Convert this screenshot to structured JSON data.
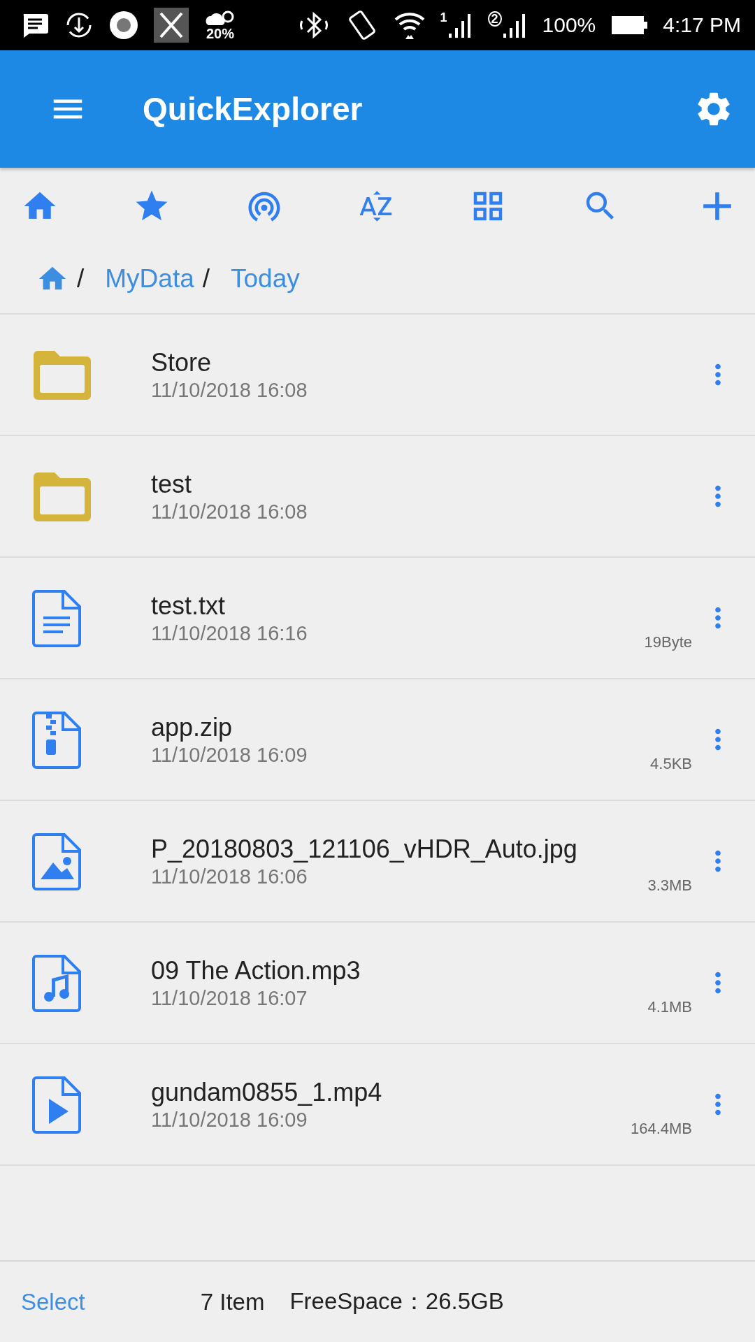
{
  "status_bar": {
    "weather_reading": "20%",
    "sim1_label": "1",
    "sim2_label": "2",
    "battery": "100%",
    "time": "4:17 PM"
  },
  "app_bar": {
    "title": "QuickExplorer"
  },
  "toolbar": [
    {
      "kind": "home"
    },
    {
      "kind": "star"
    },
    {
      "kind": "network"
    },
    {
      "kind": "sort"
    },
    {
      "kind": "grid"
    },
    {
      "kind": "search"
    },
    {
      "kind": "add"
    }
  ],
  "breadcrumb": [
    {
      "separator": "/",
      "label": "MyData"
    },
    {
      "separator": "/",
      "label": "Today"
    }
  ],
  "files": [
    {
      "name": "Store",
      "date": "11/10/2018 16:08",
      "kind": "folder"
    },
    {
      "name": "test",
      "date": "11/10/2018 16:08",
      "kind": "folder"
    },
    {
      "name": "test.txt",
      "date": "11/10/2018 16:16",
      "kind": "text",
      "size": "19Byte"
    },
    {
      "name": "app.zip",
      "date": "11/10/2018 16:09",
      "kind": "zip",
      "size": "4.5KB"
    },
    {
      "name": "P_20180803_121106_vHDR_Auto.jpg",
      "date": "11/10/2018 16:06",
      "kind": "image",
      "size": "3.3MB"
    },
    {
      "name": "09 The Action.mp3",
      "date": "11/10/2018 16:07",
      "kind": "audio",
      "size": "4.1MB"
    },
    {
      "name": "gundam0855_1.mp4",
      "date": "11/10/2018 16:09",
      "kind": "video",
      "size": "164.4MB"
    }
  ],
  "footer": {
    "select": "Select",
    "count": "7 Item",
    "free_space": "FreeSpace：26.5GB"
  }
}
